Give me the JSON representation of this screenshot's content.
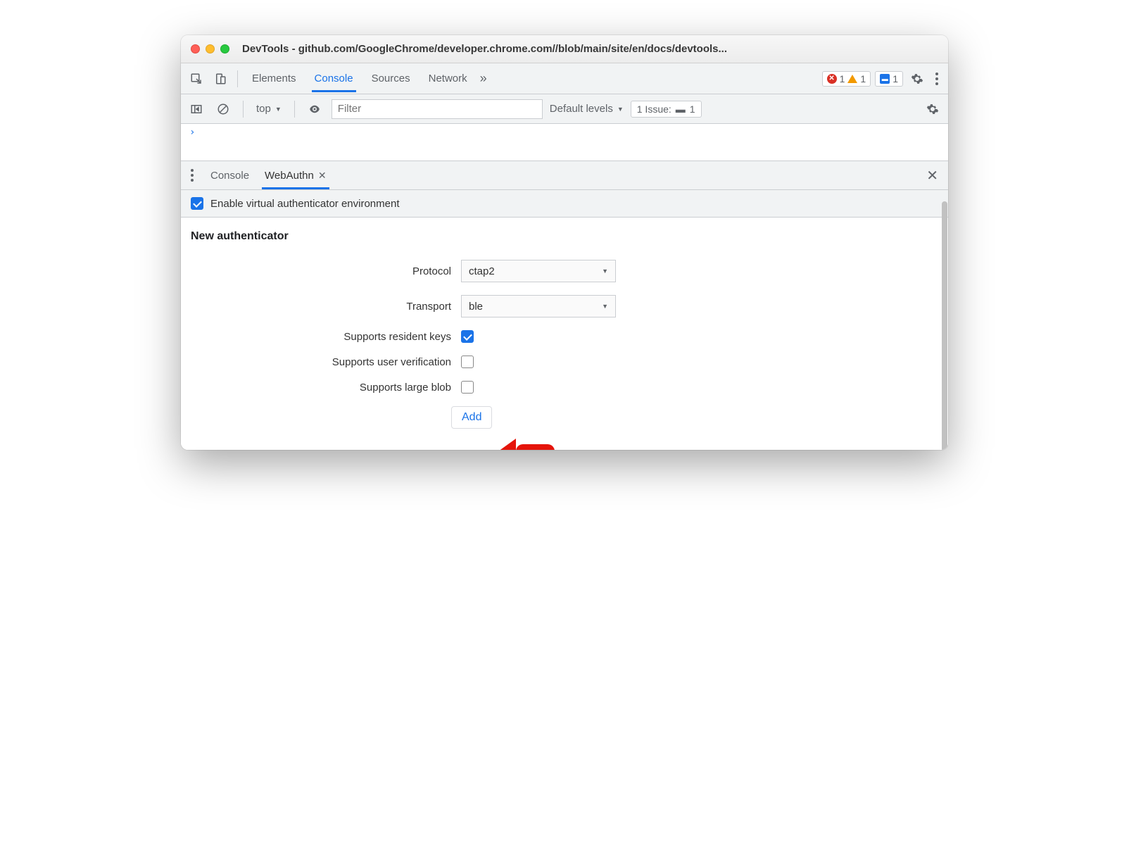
{
  "window": {
    "title": "DevTools - github.com/GoogleChrome/developer.chrome.com//blob/main/site/en/docs/devtools..."
  },
  "toolbar": {
    "tabs": [
      "Elements",
      "Console",
      "Sources",
      "Network"
    ],
    "active_tab": "Console",
    "errors_count": "1",
    "warnings_count": "1",
    "messages_count": "1"
  },
  "console_bar": {
    "context": "top",
    "filter_placeholder": "Filter",
    "levels": "Default levels",
    "issues_label": "1 Issue:",
    "issues_count": "1"
  },
  "console_prompt": "›",
  "drawer": {
    "tabs": [
      {
        "label": "Console",
        "closable": false,
        "active": false
      },
      {
        "label": "WebAuthn",
        "closable": true,
        "active": true
      }
    ]
  },
  "webauthn": {
    "enable_label": "Enable virtual authenticator environment",
    "enable_checked": true,
    "section_title": "New authenticator",
    "protocol_label": "Protocol",
    "protocol_value": "ctap2",
    "transport_label": "Transport",
    "transport_value": "ble",
    "resident_keys_label": "Supports resident keys",
    "resident_keys_checked": true,
    "user_verification_label": "Supports user verification",
    "user_verification_checked": false,
    "large_blob_label": "Supports large blob",
    "large_blob_checked": false,
    "add_button": "Add"
  }
}
